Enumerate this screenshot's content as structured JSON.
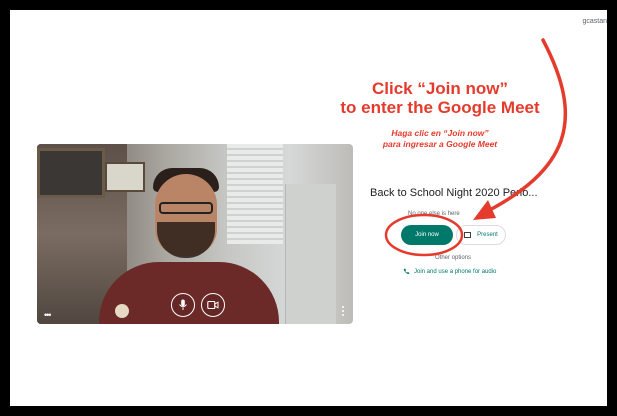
{
  "account": {
    "name": "gcastan"
  },
  "video": {
    "mic_icon": "microphone-icon",
    "camera_icon": "camera-icon"
  },
  "meeting": {
    "title": "Back to School Night 2020 Perio...",
    "status": "No one else is here",
    "join_label": "Join now",
    "present_label": "Present",
    "other_options": "Other options",
    "phone_label": "Join and use a phone for audio"
  },
  "annotation": {
    "line1": "Click “Join now”",
    "line2": "to enter the Google Meet",
    "es_line1": "Haga clic en “Join now”",
    "es_line2": "para ingresar a Google Meet",
    "color": "#e53b2c"
  },
  "colors": {
    "accent": "#00796b"
  }
}
